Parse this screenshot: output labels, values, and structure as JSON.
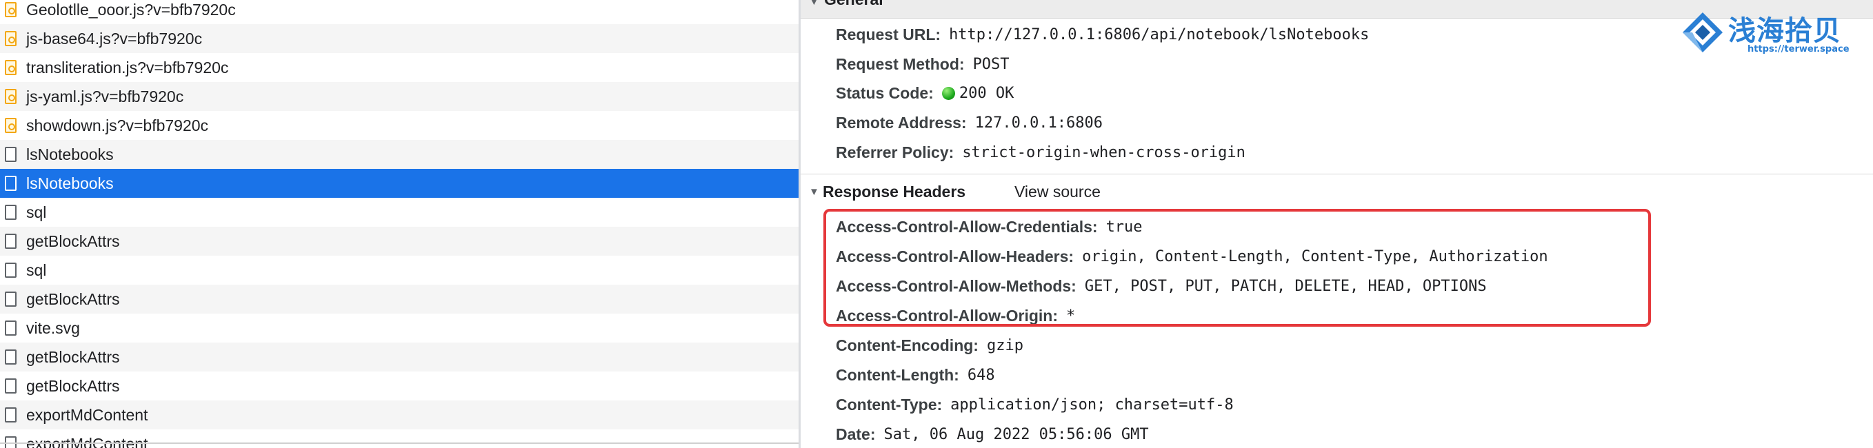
{
  "requests": [
    {
      "name": "Geolotlle_ooor.js?v=bfb7920c",
      "type": "script"
    },
    {
      "name": "js-base64.js?v=bfb7920c",
      "type": "script"
    },
    {
      "name": "transliteration.js?v=bfb7920c",
      "type": "script"
    },
    {
      "name": "js-yaml.js?v=bfb7920c",
      "type": "script"
    },
    {
      "name": "showdown.js?v=bfb7920c",
      "type": "script"
    },
    {
      "name": "lsNotebooks",
      "type": "doc"
    },
    {
      "name": "lsNotebooks",
      "type": "doc",
      "selected": true
    },
    {
      "name": "sql",
      "type": "doc"
    },
    {
      "name": "getBlockAttrs",
      "type": "doc"
    },
    {
      "name": "sql",
      "type": "doc"
    },
    {
      "name": "getBlockAttrs",
      "type": "doc"
    },
    {
      "name": "vite.svg",
      "type": "doc"
    },
    {
      "name": "getBlockAttrs",
      "type": "doc"
    },
    {
      "name": "getBlockAttrs",
      "type": "doc"
    },
    {
      "name": "exportMdContent",
      "type": "doc"
    },
    {
      "name": "exportMdContent",
      "type": "doc"
    }
  ],
  "general": {
    "title": "General",
    "request_url": {
      "key": "Request URL:",
      "value": "http://127.0.0.1:6806/api/notebook/lsNotebooks"
    },
    "request_method": {
      "key": "Request Method:",
      "value": "POST"
    },
    "status_code": {
      "key": "Status Code:",
      "value": "200 OK"
    },
    "remote_address": {
      "key": "Remote Address:",
      "value": "127.0.0.1:6806"
    },
    "referrer_policy": {
      "key": "Referrer Policy:",
      "value": "strict-origin-when-cross-origin"
    }
  },
  "response_headers": {
    "title": "Response Headers",
    "view_source": "View source",
    "items": [
      {
        "key": "Access-Control-Allow-Credentials:",
        "value": "true"
      },
      {
        "key": "Access-Control-Allow-Headers:",
        "value": "origin, Content-Length, Content-Type, Authorization"
      },
      {
        "key": "Access-Control-Allow-Methods:",
        "value": "GET, POST, PUT, PATCH, DELETE, HEAD, OPTIONS"
      },
      {
        "key": "Access-Control-Allow-Origin:",
        "value": "*"
      },
      {
        "key": "Content-Encoding:",
        "value": "gzip"
      },
      {
        "key": "Content-Length:",
        "value": "648"
      },
      {
        "key": "Content-Type:",
        "value": "application/json; charset=utf-8"
      },
      {
        "key": "Date:",
        "value": "Sat, 06 Aug 2022 05:56:06 GMT"
      }
    ]
  },
  "watermark": {
    "text": "浅海拾贝",
    "url": "https://terwer.space"
  },
  "colors": {
    "selected_row": "#1a73e8",
    "highlight_box": "#e5383b",
    "status_ok": "#1faa1f",
    "logo": "#2a7fd4"
  },
  "icons": {
    "script": "js-file-icon",
    "doc": "document-icon",
    "caret": "triangle-down-icon"
  }
}
